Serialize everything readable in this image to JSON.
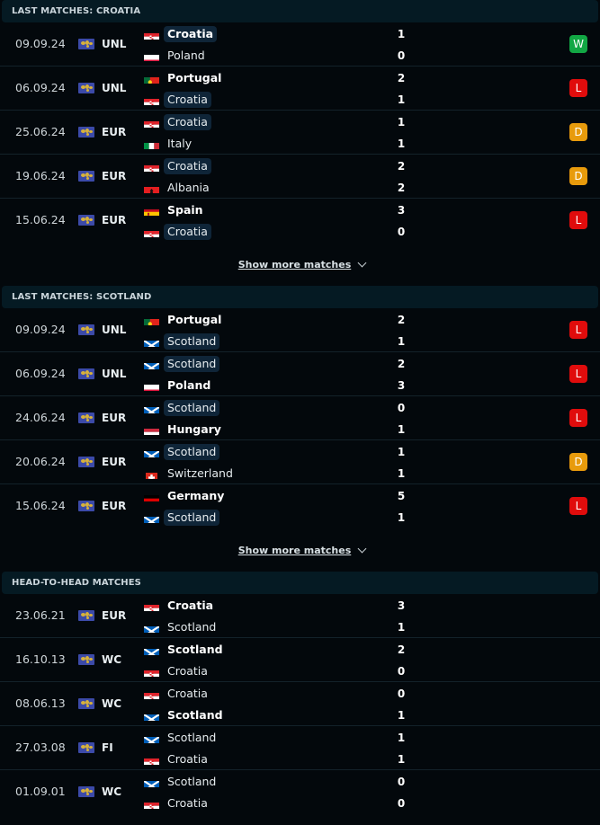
{
  "colors": {
    "win": "#12a744",
    "loss": "#e00c0c",
    "draw": "#e89b0c"
  },
  "show_more_label": "Show more matches",
  "sections": [
    {
      "title": "LAST MATCHES: CROATIA",
      "matches": [
        {
          "date": "09.09.24",
          "comp": "UNL",
          "home": {
            "name": "Croatia",
            "flag": "croatia-flag",
            "highlight": true,
            "winner": true
          },
          "away": {
            "name": "Poland",
            "flag": "poland-flag",
            "highlight": false,
            "winner": false
          },
          "home_score": "1",
          "away_score": "0",
          "result": "W"
        },
        {
          "date": "06.09.24",
          "comp": "UNL",
          "home": {
            "name": "Portugal",
            "flag": "portugal-flag",
            "highlight": false,
            "winner": true
          },
          "away": {
            "name": "Croatia",
            "flag": "croatia-flag",
            "highlight": true,
            "winner": false
          },
          "home_score": "2",
          "away_score": "1",
          "result": "L"
        },
        {
          "date": "25.06.24",
          "comp": "EUR",
          "home": {
            "name": "Croatia",
            "flag": "croatia-flag",
            "highlight": true,
            "winner": false
          },
          "away": {
            "name": "Italy",
            "flag": "italy-flag",
            "highlight": false,
            "winner": false
          },
          "home_score": "1",
          "away_score": "1",
          "result": "D"
        },
        {
          "date": "19.06.24",
          "comp": "EUR",
          "home": {
            "name": "Croatia",
            "flag": "croatia-flag",
            "highlight": true,
            "winner": false
          },
          "away": {
            "name": "Albania",
            "flag": "albania-flag",
            "highlight": false,
            "winner": false
          },
          "home_score": "2",
          "away_score": "2",
          "result": "D"
        },
        {
          "date": "15.06.24",
          "comp": "EUR",
          "home": {
            "name": "Spain",
            "flag": "spain-flag",
            "highlight": false,
            "winner": true
          },
          "away": {
            "name": "Croatia",
            "flag": "croatia-flag",
            "highlight": true,
            "winner": false
          },
          "home_score": "3",
          "away_score": "0",
          "result": "L"
        }
      ],
      "show_more": true
    },
    {
      "title": "LAST MATCHES: SCOTLAND",
      "matches": [
        {
          "date": "09.09.24",
          "comp": "UNL",
          "home": {
            "name": "Portugal",
            "flag": "portugal-flag",
            "highlight": false,
            "winner": true
          },
          "away": {
            "name": "Scotland",
            "flag": "scotland-flag",
            "highlight": true,
            "winner": false
          },
          "home_score": "2",
          "away_score": "1",
          "result": "L"
        },
        {
          "date": "06.09.24",
          "comp": "UNL",
          "home": {
            "name": "Scotland",
            "flag": "scotland-flag",
            "highlight": true,
            "winner": false
          },
          "away": {
            "name": "Poland",
            "flag": "poland-flag",
            "highlight": false,
            "winner": true
          },
          "home_score": "2",
          "away_score": "3",
          "result": "L"
        },
        {
          "date": "24.06.24",
          "comp": "EUR",
          "home": {
            "name": "Scotland",
            "flag": "scotland-flag",
            "highlight": true,
            "winner": false
          },
          "away": {
            "name": "Hungary",
            "flag": "hungary-flag",
            "highlight": false,
            "winner": true
          },
          "home_score": "0",
          "away_score": "1",
          "result": "L"
        },
        {
          "date": "20.06.24",
          "comp": "EUR",
          "home": {
            "name": "Scotland",
            "flag": "scotland-flag",
            "highlight": true,
            "winner": false
          },
          "away": {
            "name": "Switzerland",
            "flag": "switzerland-flag",
            "highlight": false,
            "winner": false
          },
          "home_score": "1",
          "away_score": "1",
          "result": "D"
        },
        {
          "date": "15.06.24",
          "comp": "EUR",
          "home": {
            "name": "Germany",
            "flag": "germany-flag",
            "highlight": false,
            "winner": true
          },
          "away": {
            "name": "Scotland",
            "flag": "scotland-flag",
            "highlight": true,
            "winner": false
          },
          "home_score": "5",
          "away_score": "1",
          "result": "L"
        }
      ],
      "show_more": true
    },
    {
      "title": "HEAD-TO-HEAD MATCHES",
      "matches": [
        {
          "date": "23.06.21",
          "comp": "EUR",
          "home": {
            "name": "Croatia",
            "flag": "croatia-flag",
            "highlight": false,
            "winner": true
          },
          "away": {
            "name": "Scotland",
            "flag": "scotland-flag",
            "highlight": false,
            "winner": false
          },
          "home_score": "3",
          "away_score": "1",
          "result": ""
        },
        {
          "date": "16.10.13",
          "comp": "WC",
          "home": {
            "name": "Scotland",
            "flag": "scotland-flag",
            "highlight": false,
            "winner": true
          },
          "away": {
            "name": "Croatia",
            "flag": "croatia-flag",
            "highlight": false,
            "winner": false
          },
          "home_score": "2",
          "away_score": "0",
          "result": ""
        },
        {
          "date": "08.06.13",
          "comp": "WC",
          "home": {
            "name": "Croatia",
            "flag": "croatia-flag",
            "highlight": false,
            "winner": false
          },
          "away": {
            "name": "Scotland",
            "flag": "scotland-flag",
            "highlight": false,
            "winner": true
          },
          "home_score": "0",
          "away_score": "1",
          "result": ""
        },
        {
          "date": "27.03.08",
          "comp": "FI",
          "home": {
            "name": "Scotland",
            "flag": "scotland-flag",
            "highlight": false,
            "winner": false
          },
          "away": {
            "name": "Croatia",
            "flag": "croatia-flag",
            "highlight": false,
            "winner": false
          },
          "home_score": "1",
          "away_score": "1",
          "result": ""
        },
        {
          "date": "01.09.01",
          "comp": "WC",
          "home": {
            "name": "Scotland",
            "flag": "scotland-flag",
            "highlight": false,
            "winner": false
          },
          "away": {
            "name": "Croatia",
            "flag": "croatia-flag",
            "highlight": false,
            "winner": false
          },
          "home_score": "0",
          "away_score": "0",
          "result": ""
        }
      ],
      "show_more": false
    }
  ]
}
